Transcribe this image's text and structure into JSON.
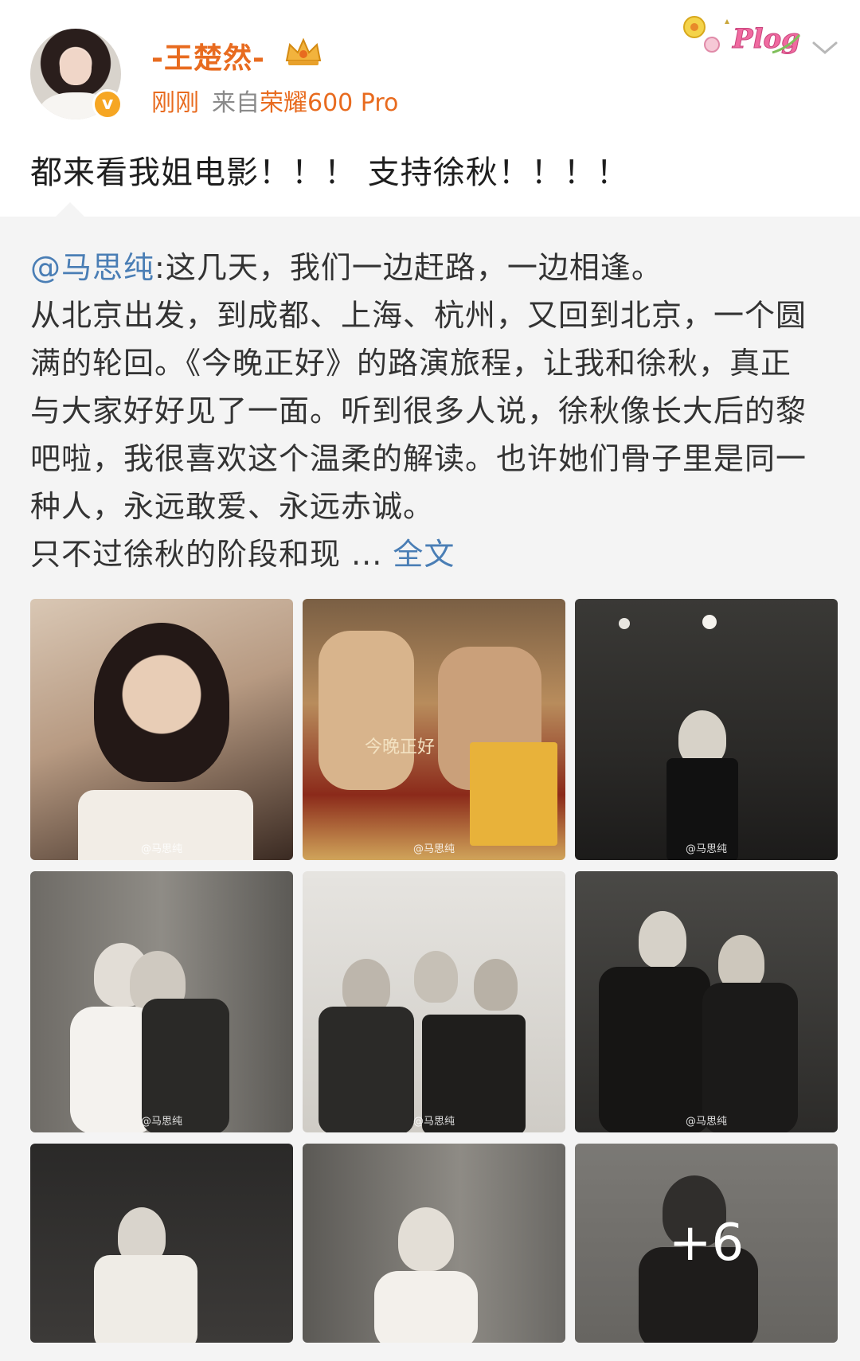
{
  "user": {
    "name": "-王楚然-",
    "time": "刚刚",
    "source_prefix": "来自",
    "device": "荣耀600 Pro",
    "badge": "Plog"
  },
  "post": {
    "text": "都来看我姐电影！！！ 支持徐秋！！！！"
  },
  "repost": {
    "mention": "@马思纯",
    "lines": [
      ":这几天，我们一边赶路，一边相逢。",
      "从北京出发，到成都、上海、杭州，又回到北京，一个圆",
      "满的轮回。《今晚正好》的路演旅程，让我和徐秋，真正",
      "与大家好好见了一面。听到很多人说，徐秋像长大后的黎",
      "吧啦，我很喜欢这个温柔的解读。也许她们骨子里是同一",
      "种人，永远敢爱、永远赤诚。",
      "只不过徐秋的阶段和现 ... "
    ],
    "fulltext_link": "全文"
  },
  "images": {
    "watermark": "@马思纯",
    "more_count": "+6",
    "tile_text_2": "今晚正好"
  },
  "colors": {
    "accent_orange": "#e86b1f",
    "link_blue": "#4a7eb5",
    "repost_bg": "#f4f4f4"
  }
}
